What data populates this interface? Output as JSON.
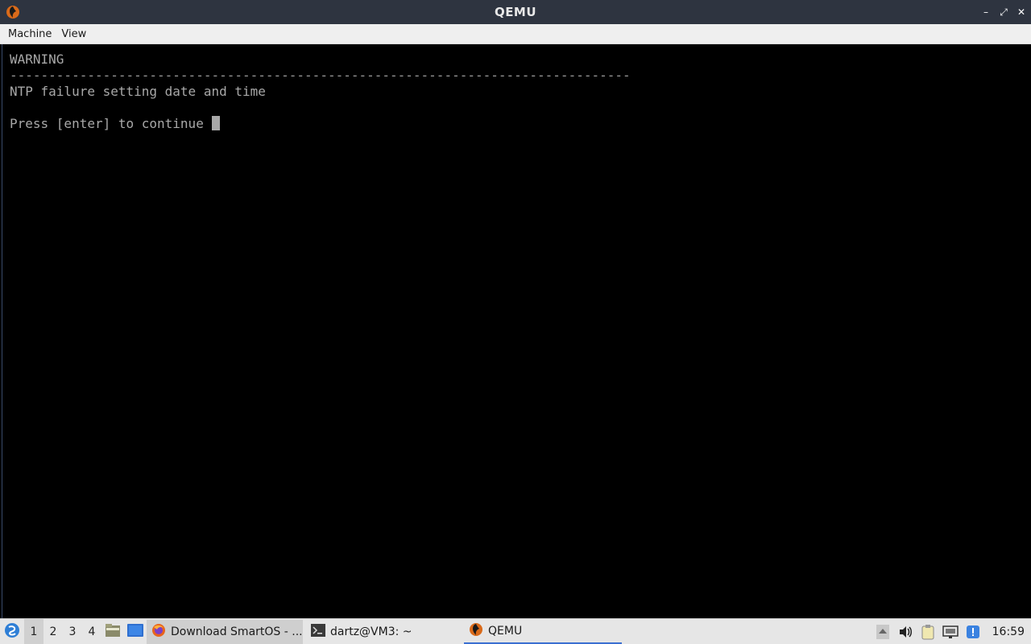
{
  "window": {
    "title": "QEMU",
    "app_icon": "qemu-icon",
    "controls": {
      "minimize": "–",
      "maximize": "⤢",
      "close": "✕"
    }
  },
  "menubar": {
    "items": [
      {
        "label": "Machine"
      },
      {
        "label": "View"
      }
    ]
  },
  "console": {
    "lines": [
      "WARNING",
      "--------------------------------------------------------------------------------",
      "NTP failure setting date and time",
      "",
      "Press [enter] to continue "
    ]
  },
  "taskbar": {
    "start_icon": "lxqt-start-icon",
    "desktops": [
      "1",
      "2",
      "3",
      "4"
    ],
    "active_desktop": "1",
    "quicklaunch": [
      {
        "icon": "file-manager-icon"
      },
      {
        "icon": "show-desktop-icon"
      }
    ],
    "tasks": [
      {
        "icon": "firefox-icon",
        "label": "Download SmartOS - ..."
      },
      {
        "icon": "terminal-icon",
        "label": "dartz@VM3: ~"
      },
      {
        "icon": "qemu-icon",
        "label": "QEMU"
      }
    ],
    "tray": [
      {
        "icon": "tray-arrow-icon"
      },
      {
        "icon": "volume-icon"
      },
      {
        "icon": "clipboard-icon"
      },
      {
        "icon": "network-icon"
      },
      {
        "icon": "update-notifier-icon"
      }
    ],
    "clock": "16:59"
  },
  "colors": {
    "titlebar": "#2e3440",
    "console_bg": "#000000",
    "console_fg": "#a8a8a8",
    "taskbar_bg": "#e6e6e6",
    "active_task_underline": "#3b6fd1"
  }
}
